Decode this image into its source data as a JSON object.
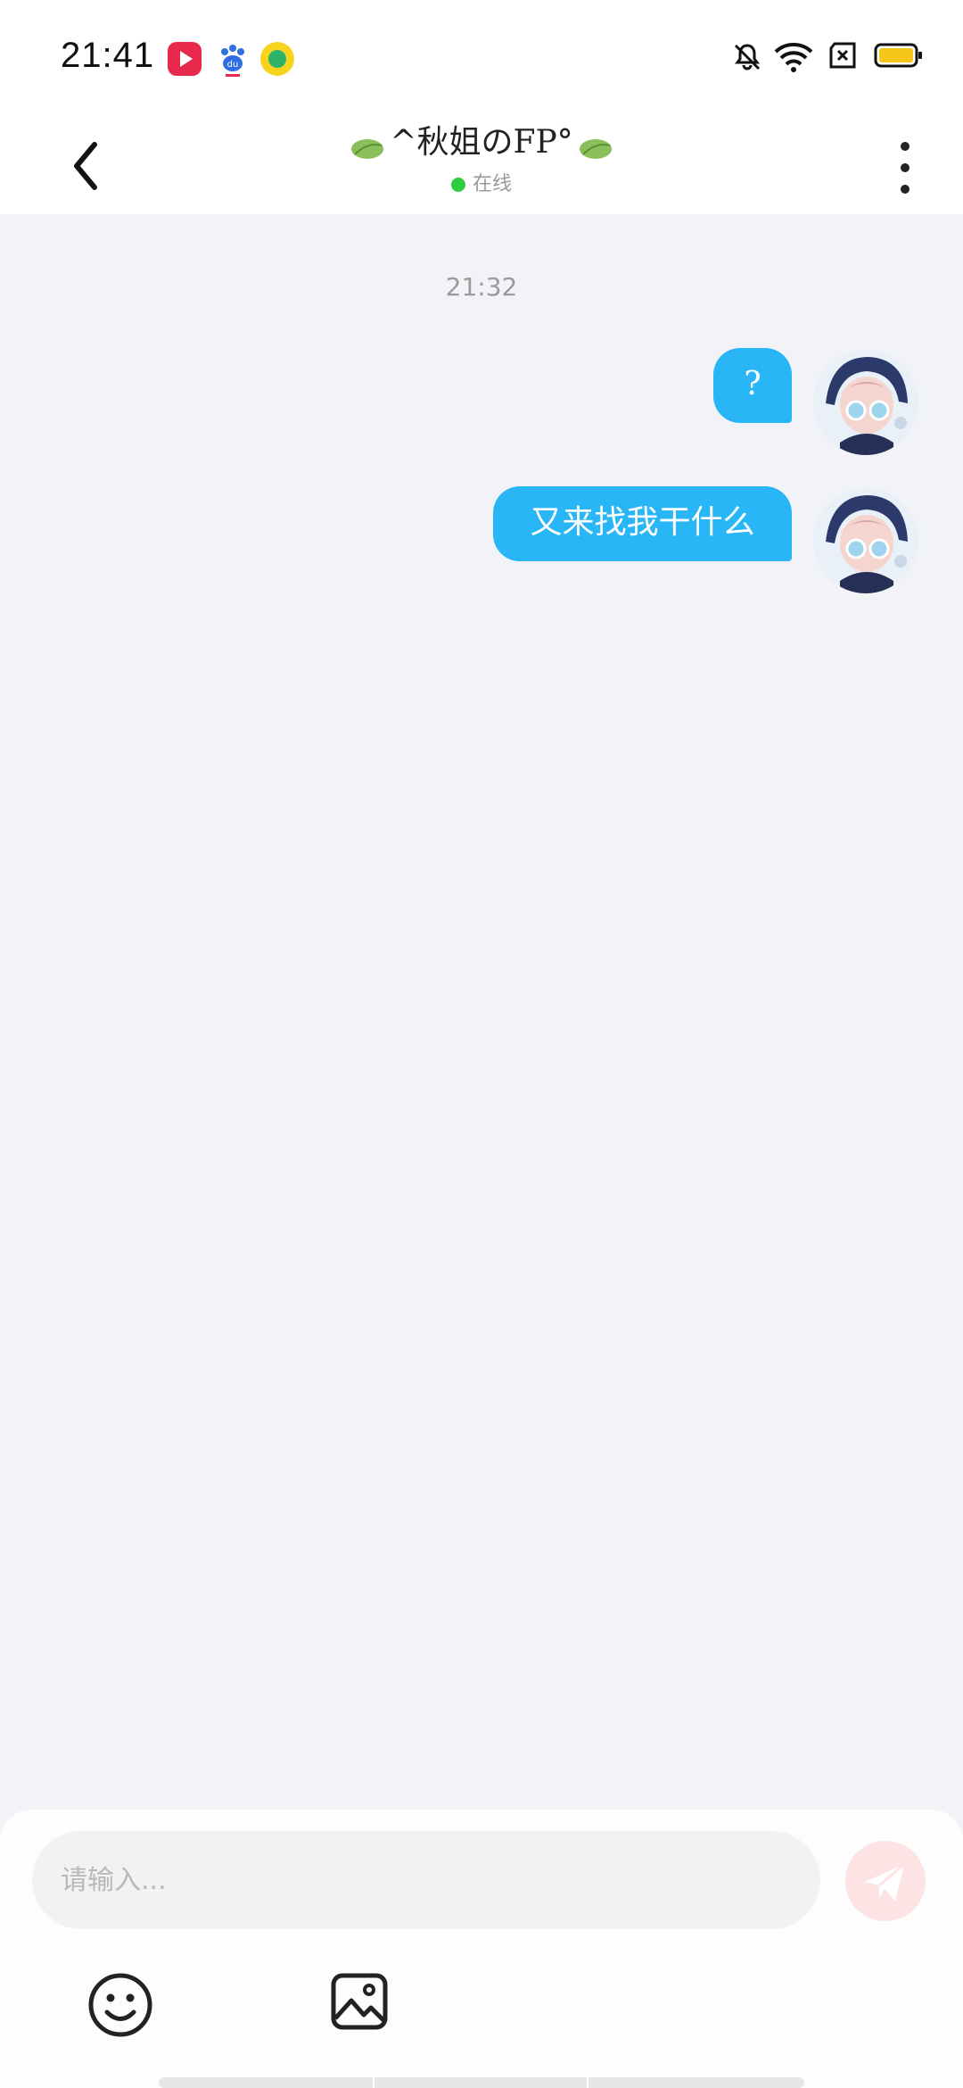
{
  "status_bar": {
    "time": "21:41",
    "app_icons": [
      "video-app-icon",
      "baidu-icon",
      "music-app-icon"
    ],
    "system_icons": [
      "bell-off-icon",
      "wifi-icon",
      "sim-off-icon",
      "battery-icon"
    ]
  },
  "header": {
    "title": "^秋姐のFP°",
    "status": "在线"
  },
  "chat": {
    "timestamp": "21:32",
    "messages": [
      {
        "text": "?",
        "from": "me"
      },
      {
        "text": "又来找我干什么",
        "from": "me"
      }
    ]
  },
  "input": {
    "placeholder": "请输入..."
  },
  "colors": {
    "bubble": "#29b6f6",
    "online_dot": "#2ecc40",
    "send_button": "#fde3e3",
    "background": "#f2f3f7"
  }
}
